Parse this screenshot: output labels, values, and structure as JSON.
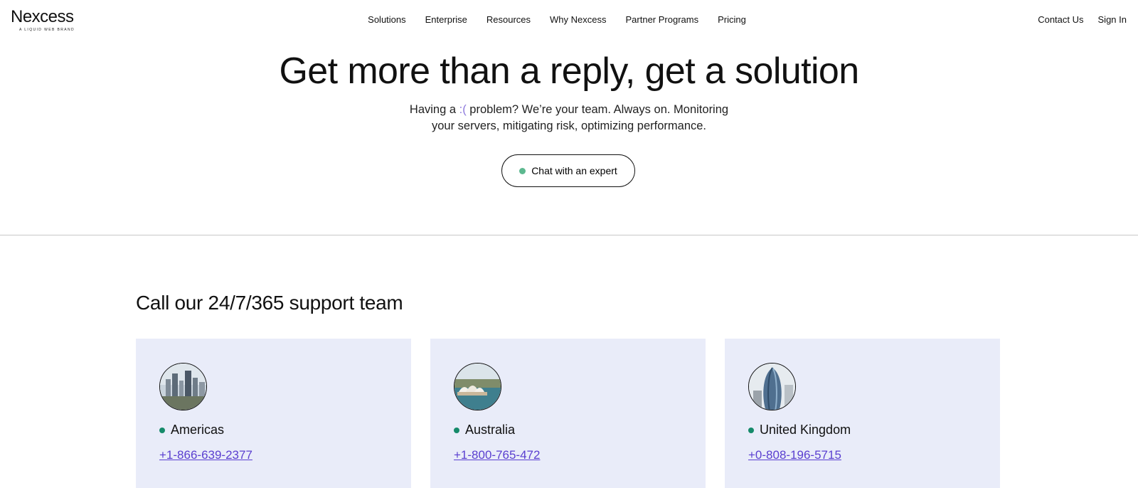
{
  "header": {
    "logo": "Nexcess",
    "logo_tagline": "A LIQUID WEB BRAND",
    "nav": [
      "Solutions",
      "Enterprise",
      "Resources",
      "Why Nexcess",
      "Partner Programs",
      "Pricing"
    ],
    "contact": "Contact Us",
    "sign_in": "Sign In"
  },
  "hero": {
    "title": "Get more than a reply, get a solution",
    "subtitle_pre": "Having a ",
    "subtitle_emoticon": ":(",
    "subtitle_post": " problem? We’re your team. Always on. Monitoring",
    "subtitle_line2": "your servers, mitigating risk, optimizing performance.",
    "chat_button": "Chat with an expert",
    "status_color": "#5cb88f"
  },
  "support": {
    "title": "Call our 24/7/365 support team",
    "accent": "#5a3fd0",
    "cards": [
      {
        "region": "Americas",
        "phone": "+1-866-639-2377",
        "image": "city-skyline-image"
      },
      {
        "region": "Australia",
        "phone": "+1-800-765-472",
        "image": "sydney-opera-house-image"
      },
      {
        "region": "United Kingdom",
        "phone": "+0-808-196-5715",
        "image": "london-gherkin-image"
      }
    ]
  }
}
